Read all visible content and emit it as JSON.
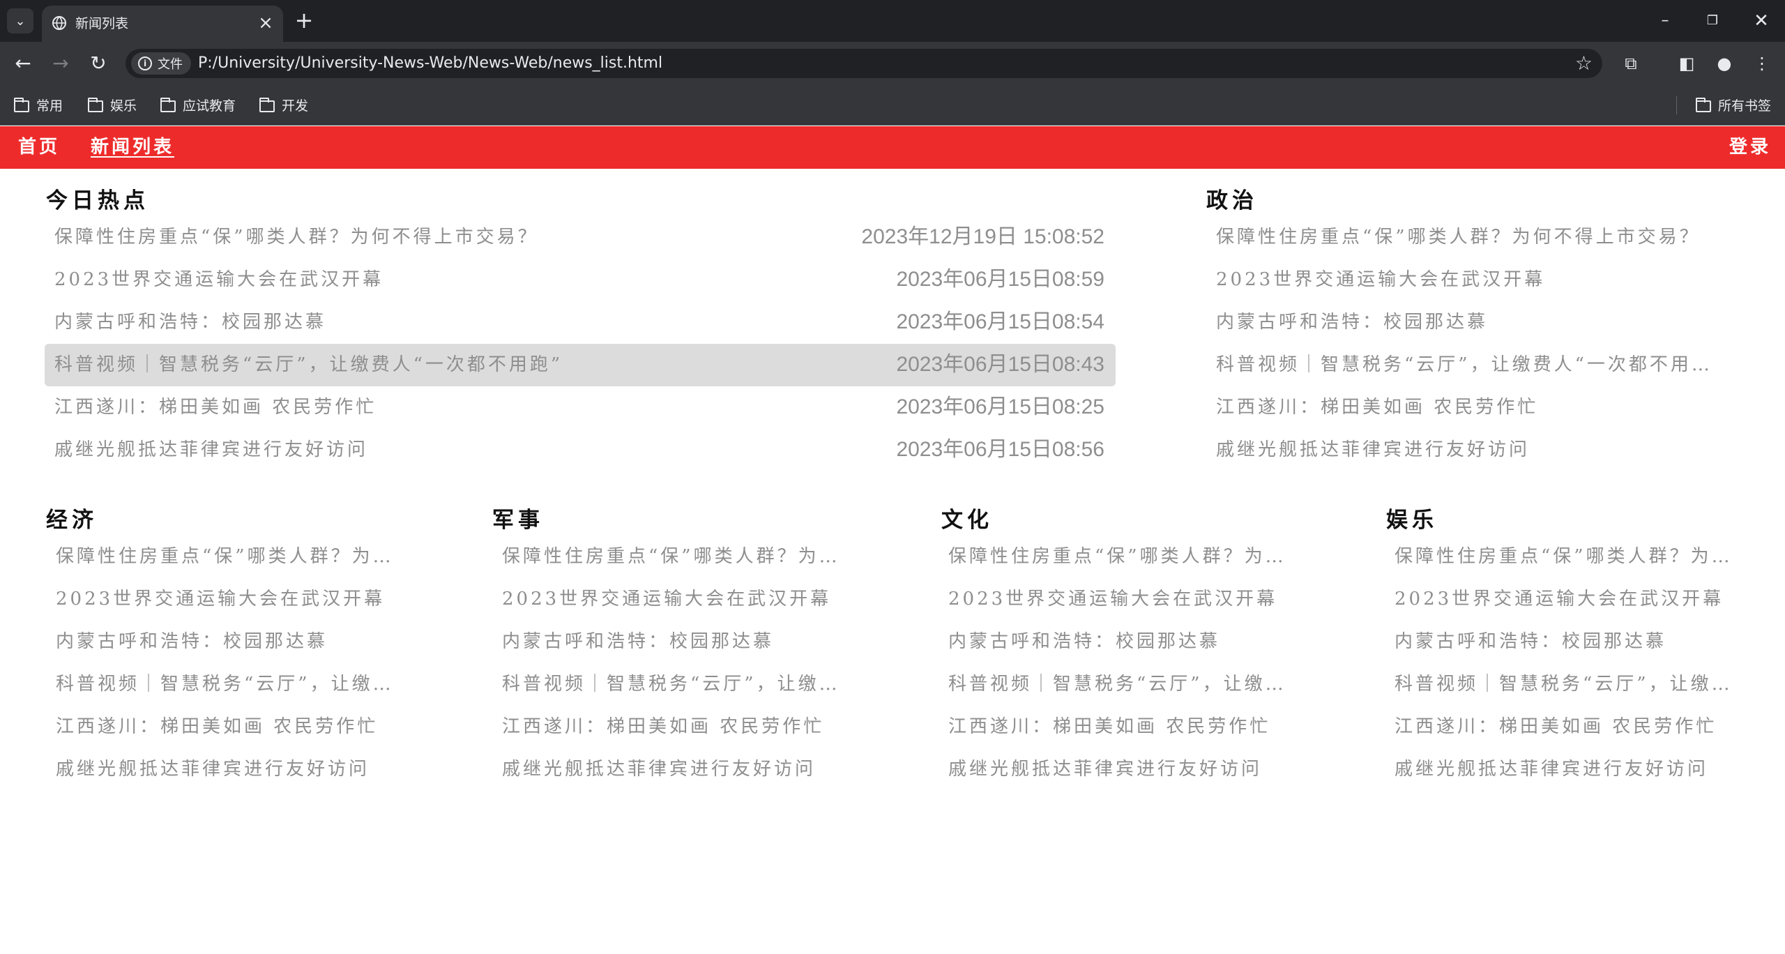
{
  "browser": {
    "tab_title": "新闻列表",
    "url_chip": "文件",
    "url": "P:/University/University-News-Web/News-Web/news_list.html",
    "bookmarks": [
      "常用",
      "娱乐",
      "应试教育",
      "开发"
    ],
    "all_bookmarks": "所有书签"
  },
  "nav": {
    "home": "首页",
    "news_list": "新闻列表",
    "login": "登录"
  },
  "sections": {
    "hot": {
      "title": "今日热点",
      "items": [
        {
          "title": "保障性住房重点“保”哪类人群？为何不得上市交易？",
          "time": "2023年12月19日 15:08:52"
        },
        {
          "title": "2023世界交通运输大会在武汉开幕",
          "time": "2023年06月15日08:59"
        },
        {
          "title": "内蒙古呼和浩特：校园那达慕",
          "time": "2023年06月15日08:54"
        },
        {
          "title": "科普视频｜智慧税务“云厅”，让缴费人“一次都不用跑”",
          "time": "2023年06月15日08:43"
        },
        {
          "title": "江西遂川：梯田美如画 农民劳作忙",
          "time": "2023年06月15日08:25"
        },
        {
          "title": "戚继光舰抵达菲律宾进行友好访问",
          "time": "2023年06月15日08:56"
        }
      ]
    },
    "politics": {
      "title": "政治",
      "items": [
        "保障性住房重点“保”哪类人群？为何不得上市交易？",
        "2023世界交通运输大会在武汉开幕",
        "内蒙古呼和浩特：校园那达慕",
        "科普视频｜智慧税务“云厅”，让缴费人“一次都不用跑”",
        "江西遂川：梯田美如画 农民劳作忙",
        "戚继光舰抵达菲律宾进行友好访问"
      ]
    },
    "economy": {
      "title": "经济",
      "items": [
        "保障性住房重点“保”哪类人群？为何不得上市交易？",
        "2023世界交通运输大会在武汉开幕",
        "内蒙古呼和浩特：校园那达慕",
        "科普视频｜智慧税务“云厅”，让缴费人“一次都不用跑”",
        "江西遂川：梯田美如画 农民劳作忙",
        "戚继光舰抵达菲律宾进行友好访问"
      ]
    },
    "military": {
      "title": "军事",
      "items": [
        "保障性住房重点“保”哪类人群？为何不得上市交易？",
        "2023世界交通运输大会在武汉开幕",
        "内蒙古呼和浩特：校园那达慕",
        "科普视频｜智慧税务“云厅”，让缴费人“一次都不用跑”",
        "江西遂川：梯田美如画 农民劳作忙",
        "戚继光舰抵达菲律宾进行友好访问"
      ]
    },
    "culture": {
      "title": "文化",
      "items": [
        "保障性住房重点“保”哪类人群？为何不得上市交易？",
        "2023世界交通运输大会在武汉开幕",
        "内蒙古呼和浩特：校园那达慕",
        "科普视频｜智慧税务“云厅”，让缴费人“一次都不用跑”",
        "江西遂川：梯田美如画 农民劳作忙",
        "戚继光舰抵达菲律宾进行友好访问"
      ]
    },
    "entertainment": {
      "title": "娱乐",
      "items": [
        "保障性住房重点“保”哪类人群？为何不得上市交易？",
        "2023世界交通运输大会在武汉开幕",
        "内蒙古呼和浩特：校园那达慕",
        "科普视频｜智慧税务“云厅”，让缴费人“一次都不用跑”",
        "江西遂川：梯田美如画 农民劳作忙",
        "戚继光舰抵达菲律宾进行友好访问"
      ]
    }
  }
}
